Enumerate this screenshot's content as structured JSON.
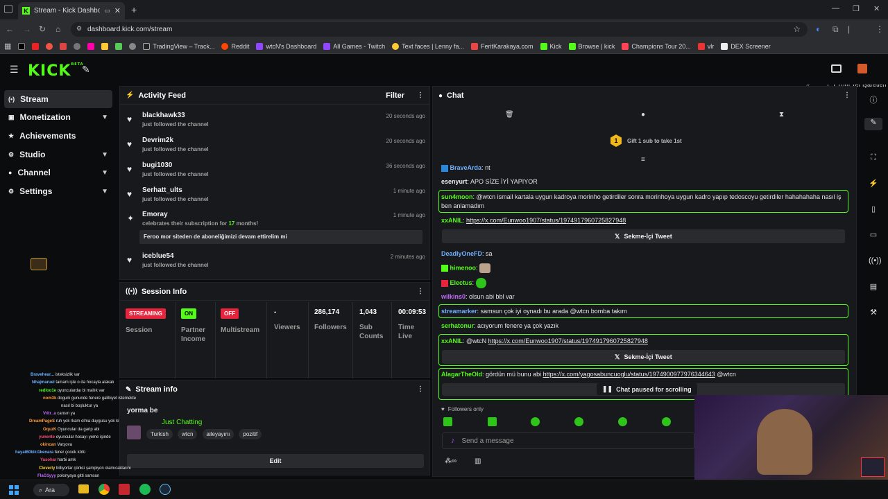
{
  "browser": {
    "tab_title": "Stream - Kick Dashboard",
    "url": "dashboard.kick.com/stream",
    "bookmarks": [
      "TradingView – Track...",
      "Reddit",
      "wtcN's Dashboard",
      "All Games - Twitch",
      "Text faces | Lenny fa...",
      "FeritKarakaya.com",
      "Kick",
      "Browse | kick",
      "Champions Tour 20...",
      "vlr",
      "DEX Screener"
    ],
    "bookmarks_folder": "Tüm Yer İşaretleri"
  },
  "header": {
    "logo": "KICK",
    "logo_sup": "BETA"
  },
  "sidebar": {
    "items": [
      {
        "label": "Stream",
        "icon": "broadcast-icon",
        "active": true
      },
      {
        "label": "Monetization",
        "icon": "card-icon"
      },
      {
        "label": "Achievements",
        "icon": "trophy-icon"
      },
      {
        "label": "Studio",
        "icon": "gear-icon"
      },
      {
        "label": "Channel",
        "icon": "user-icon"
      },
      {
        "label": "Settings",
        "icon": "gear-icon"
      }
    ]
  },
  "activity": {
    "title": "Activity Feed",
    "filter": "Filter",
    "items": [
      {
        "name": "blackhawk33",
        "sub": "just followed the channel",
        "time": "20 seconds ago"
      },
      {
        "name": "Devrim2k",
        "sub": "just followed the channel",
        "time": "20 seconds ago"
      },
      {
        "name": "bugi1030",
        "sub": "just followed the channel",
        "time": "36 seconds ago"
      },
      {
        "name": "Serhatt_ults",
        "sub": "just followed the channel",
        "time": "1 minute ago"
      },
      {
        "name": "Emoray",
        "sub_pre": "celebrates their subscription for ",
        "sub_num": "17",
        "sub_post": " months!",
        "time": "1 minute ago",
        "message": "Feroo mor siteden de aboneliğimizi devam ettirelim mi"
      },
      {
        "name": "iceblue54",
        "sub": "just followed the channel",
        "time": "2 minutes ago"
      }
    ]
  },
  "session": {
    "title": "Session Info",
    "streaming_badge": "STREAMING",
    "session_label": "Session",
    "on_badge": "ON",
    "partner_label": "Partner Income",
    "off_badge": "OFF",
    "multistream_label": "Multistream",
    "viewers_value": "-",
    "viewers_label": "Viewers",
    "followers_value": "286,174",
    "followers_label": "Followers",
    "subs_value": "1,043",
    "subs_label": "Sub Counts",
    "time_value": "00:09:53",
    "time_label": "Time Live"
  },
  "streaminfo": {
    "title": "Stream info",
    "stream_title": "yorma be",
    "category": "Just Chatting",
    "tags": [
      "Turkish",
      "wtcn",
      "aileyayını",
      "pozitif"
    ],
    "edit": "Edit"
  },
  "chat": {
    "title": "Chat",
    "gift_count": "1",
    "gift_text": "Gift 1 sub to take 1st",
    "messages": [
      {
        "user": "BraveArda",
        "text": "nt",
        "color": "#6fb0ff"
      },
      {
        "user": "esenyurt",
        "text": "APO SİZE İYİ YAPIYOR",
        "color": "#f0f0f0"
      },
      {
        "user": "sun4moon",
        "text": "@wtcn ismail kartala uygun kadroya morinho getirdiler sonra morinhoya uygun kadro yapıp tedoscoyu getirdiler hahahahaha nasıl iş ben anlamadım",
        "color": "#53fc18"
      },
      {
        "user": "xxANIL",
        "link": "https://x.com/Eunwoo1907/status/1974917960725827948",
        "color": "#53fc18"
      },
      {
        "user": "DeadlyOneFD",
        "text": "sa",
        "color": "#6fb0ff"
      },
      {
        "user": "himenoo",
        "text": "",
        "color": "#53fc18"
      },
      {
        "user": "Electus",
        "text": "",
        "color": "#53fc18"
      },
      {
        "user": "wilkins0",
        "text": "olsun abi bbl var",
        "color": "#c46cff"
      },
      {
        "user": "streamarker",
        "text": "samsun çok iyi oynadı bu arada @wtcn bomba takım",
        "color": "#6fb0ff"
      },
      {
        "user": "serhatonur",
        "text": "acıyorum fenere ya çok yazık",
        "color": "#53fc18"
      },
      {
        "user": "xxANIL",
        "pre": "@wtcN ",
        "link": "https://x.com/Eunwoo1907/status/1974917960725827948",
        "color": "#53fc18"
      },
      {
        "user": "AlagarTheOld",
        "pre": "gördün mü bunu abi ",
        "link": "https://x.com/yagosabuncuoglu/status/1974900977976344643",
        "post": " @wtcn",
        "color": "#53fc18"
      }
    ],
    "embed_label": "Sekme-İçi Tweet",
    "paused": "Chat paused for scrolling",
    "followers_only": "Followers only",
    "placeholder": "Send a message"
  },
  "overlay": {
    "lines": [
      {
        "u": "Bravehear...",
        "t": "isteksizlik var",
        "c": "#6fb0ff"
      },
      {
        "u": "Nhajmaruel",
        "t": "tamam işte o da hocayla alakalı",
        "c": "#6fb0ff"
      },
      {
        "u": "redloo1e",
        "t": "oyunculardaı bi mallık var",
        "c": "#53fc18"
      },
      {
        "u": "nom3k",
        "t": "dogum gununde fenere galibiyet istemekte",
        "c": "#ff9a3c"
      },
      {
        "u": "",
        "t": "nasıl bi boşluktur ya",
        "c": "#ffffff"
      },
      {
        "u": "Vritr_a",
        "t": "cansın ya",
        "c": "#c46cff"
      },
      {
        "u": "DreamPageS",
        "t": "ruh yok rkam olma duygusu yok ki",
        "c": "#ff9a3c"
      },
      {
        "u": "OquzK",
        "t": "Oyuncular da garip abi",
        "c": "#ff9a3c"
      },
      {
        "u": "yunente",
        "t": "oyuncular hocayı yeme işinde",
        "c": "#ff4f7a"
      },
      {
        "u": "okincan",
        "t": "Varşova",
        "c": "#ff9a3c"
      },
      {
        "u": "hayat60blzi1kenara",
        "t": "fener çoook kötü",
        "c": "#6fb0ff"
      },
      {
        "u": "Yasohar",
        "t": "harbi amk",
        "c": "#ff4f7a"
      },
      {
        "u": "Cleverly",
        "t": "billiyorlar çünkü şampiyon olamıcaklarını",
        "c": "#ffcc33"
      },
      {
        "u": "FlaG1yyy",
        "t": "polonyaya gitti samsun",
        "c": "#c46cff"
      }
    ]
  },
  "taskbar": {
    "search": "Ara"
  }
}
